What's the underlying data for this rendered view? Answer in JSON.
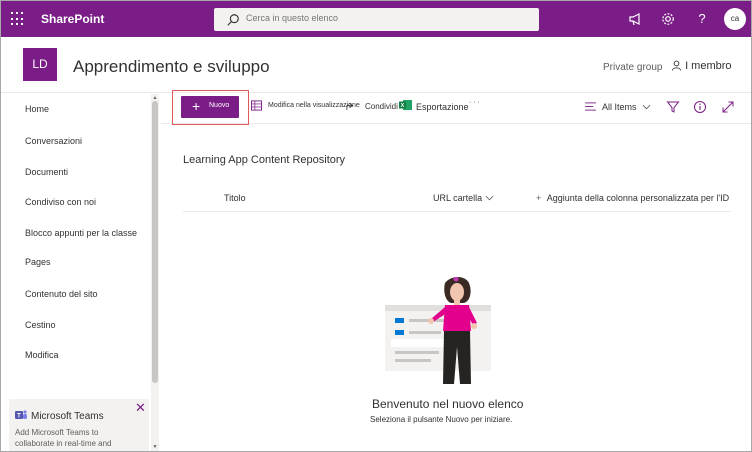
{
  "suitebar": {
    "app_name": "SharePoint",
    "search_placeholder": "Cerca in questo elenco",
    "user_initials": "ca",
    "help_label": "?"
  },
  "site": {
    "logo_initials": "LD",
    "title": "Apprendimento e sviluppo",
    "group_type": "Private group",
    "members_label": "I membro"
  },
  "nav": {
    "items": [
      {
        "label": "Home"
      },
      {
        "label": "Conversazioni"
      },
      {
        "label": "Documenti"
      },
      {
        "label": "Condiviso con noi"
      },
      {
        "label": "Blocco appunti per la classe"
      },
      {
        "label": "Pages"
      },
      {
        "label": "Contenuto del sito"
      },
      {
        "label": "Cestino"
      },
      {
        "label": "Modifica"
      }
    ],
    "teams": {
      "title": "Microsoft Teams",
      "description": "Add Microsoft Teams to collaborate in real-time and"
    }
  },
  "commandbar": {
    "new_label": "Nuovo",
    "edit_grid_label": "Modifica nella visualizzazione",
    "share_label": "Condividi",
    "export_label": "Esportazione",
    "more_label": "· · ·",
    "view_label": "All Items"
  },
  "list": {
    "title": "Learning App Content Repository",
    "columns": {
      "title": "Titolo",
      "url": "URL cartella",
      "add_column": "Aggiunta della colonna personalizzata per l'ID"
    },
    "empty_title": "Benvenuto nel nuovo elenco",
    "empty_subtitle": "Seleziona il pulsante Nuovo per iniziare."
  },
  "colors": {
    "brand": "#7a1d86",
    "highlight_outline": "#e05a5a"
  }
}
